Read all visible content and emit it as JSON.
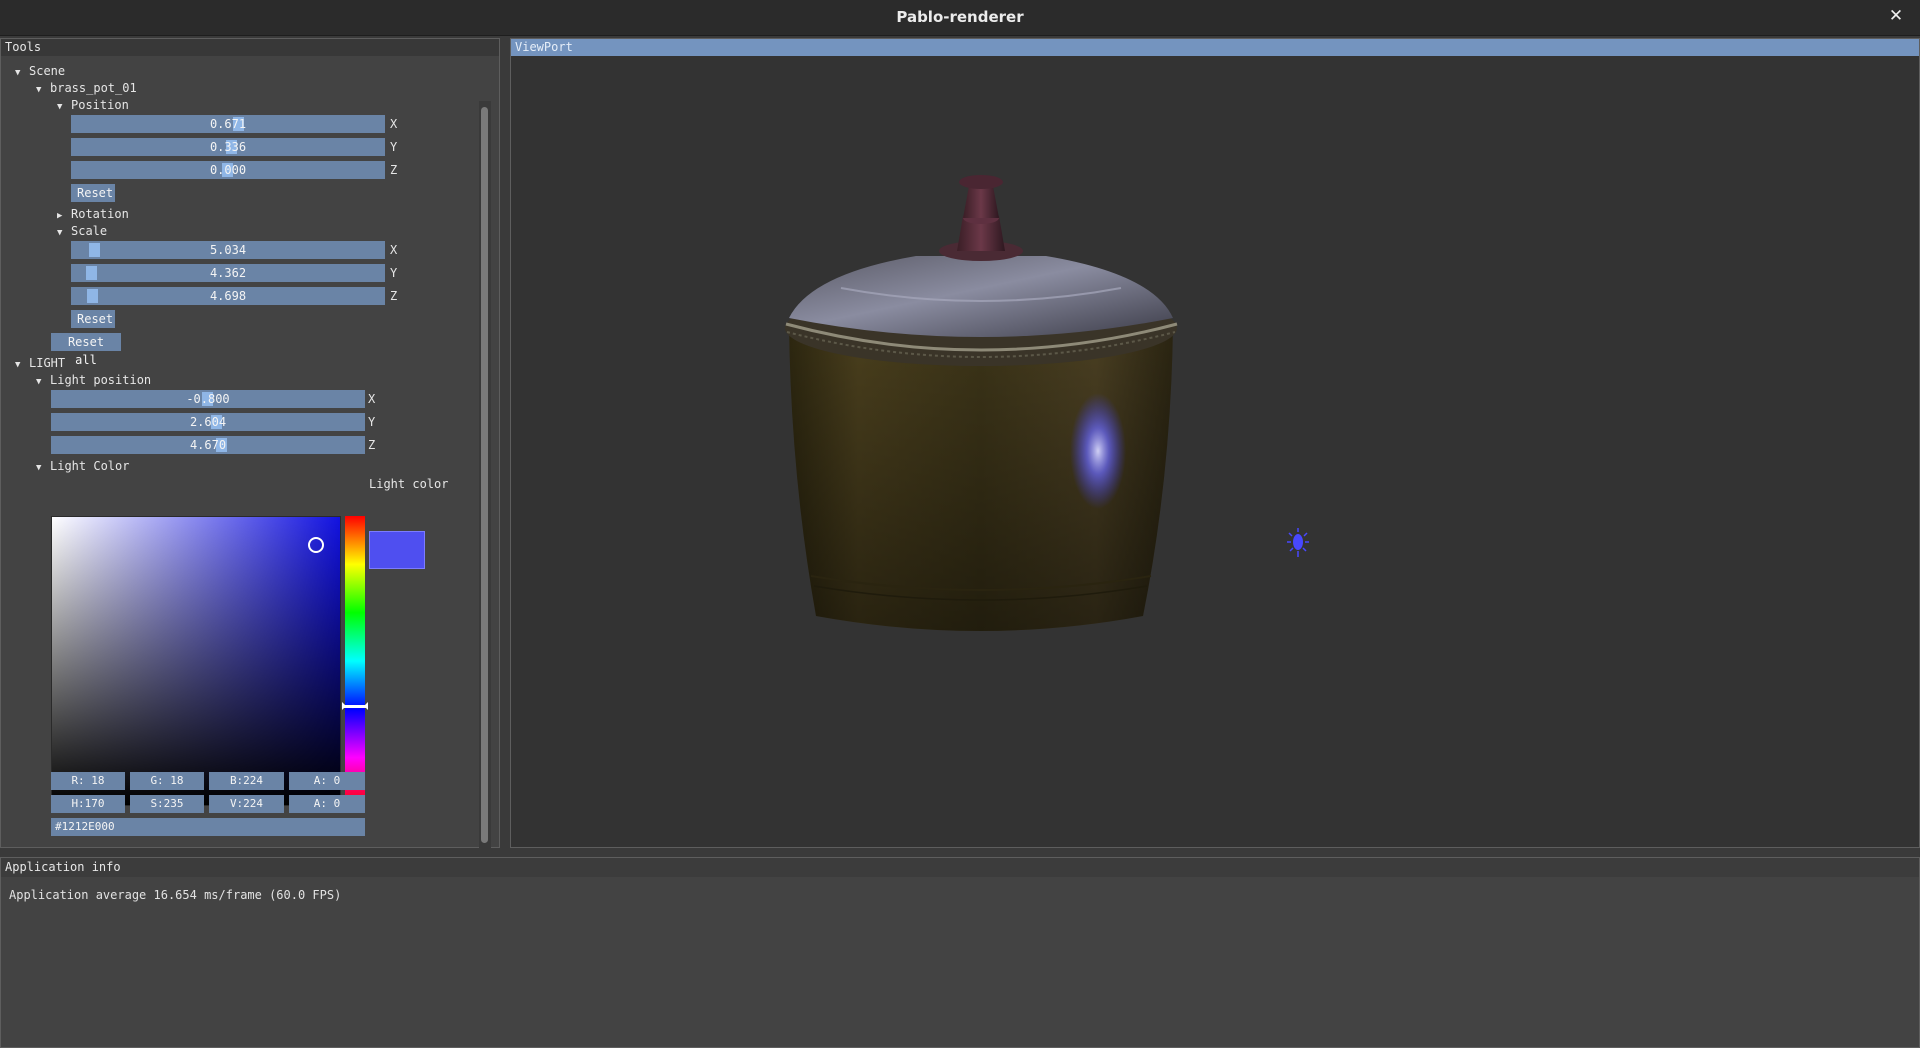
{
  "app": {
    "title": "Pablo-renderer",
    "close_glyph": "✕"
  },
  "tools": {
    "title": "Tools",
    "scene_label": "Scene",
    "object_label": "brass_pot_01",
    "position": {
      "label": "Position",
      "x": "0.671",
      "y": "0.336",
      "z": "0.000",
      "reset_label": "Reset"
    },
    "rotation": {
      "label": "Rotation"
    },
    "scale": {
      "label": "Scale",
      "x": "5.034",
      "y": "4.362",
      "z": "4.698",
      "reset_label": "Reset"
    },
    "reset_all_label": "Reset all",
    "light": {
      "label": "LIGHT",
      "position_label": "Light position",
      "x": "-0.800",
      "y": "2.604",
      "z": "4.670",
      "color_label": "Light Color",
      "picker_label": "Light color",
      "rgba": {
        "r": "R: 18",
        "g": "G: 18",
        "b": "B:224",
        "a": "A:  0"
      },
      "hsva": {
        "h": "H:170",
        "s": "S:235",
        "v": "V:224",
        "a": "A:  0"
      },
      "hex": "#1212E000",
      "color": "#1212e0"
    },
    "axis": {
      "x": "X",
      "y": "Y",
      "z": "Z"
    }
  },
  "viewport": {
    "title": "ViewPort"
  },
  "app_info": {
    "title": "Application info",
    "text": "Application average 16.654 ms/frame (60.0 FPS)"
  },
  "colors": {
    "accent": "#6a84a6",
    "accent_active": "#7494bf",
    "panel_bg": "#434343",
    "viewport_bg": "#333333"
  },
  "icons": {
    "expanded": "triangle-down-icon",
    "collapsed": "triangle-right-icon",
    "light": "light-bulb-icon",
    "close": "close-icon"
  }
}
